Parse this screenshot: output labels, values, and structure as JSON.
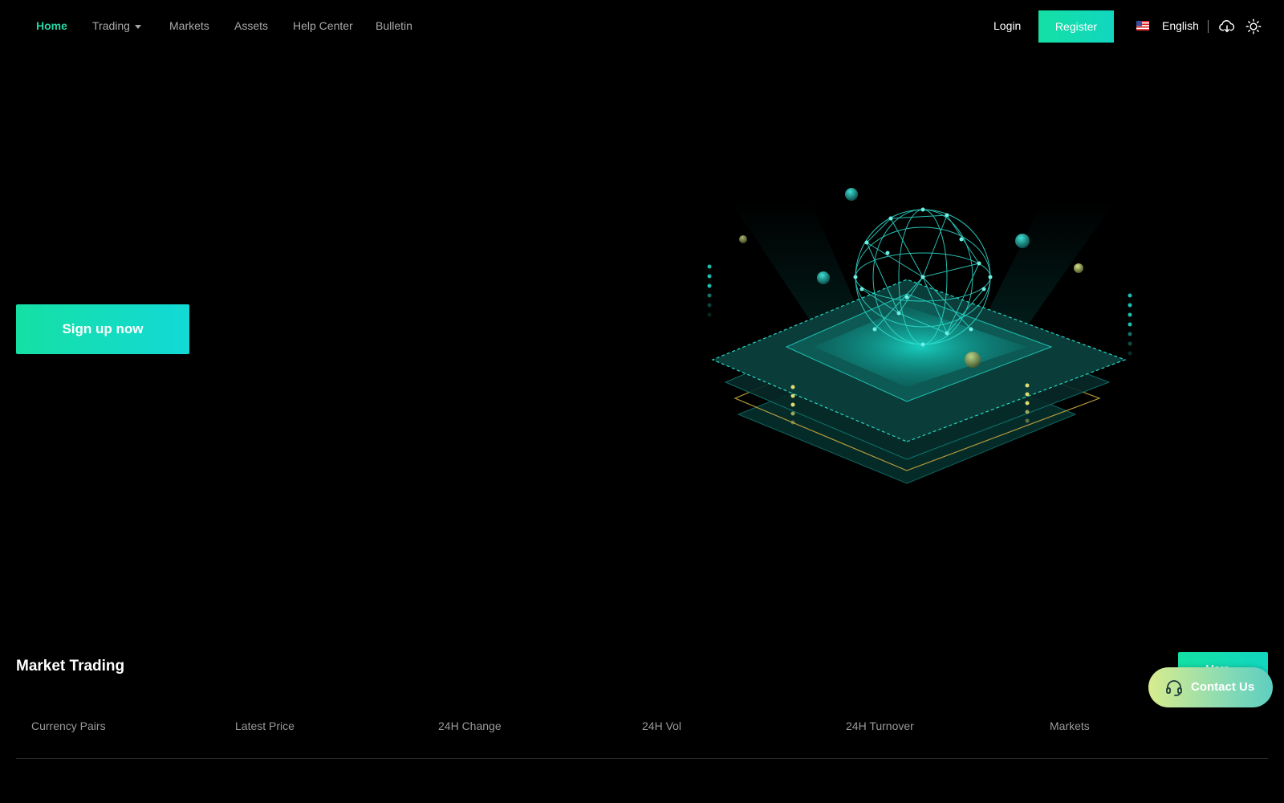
{
  "nav": {
    "links": [
      {
        "label": "Home",
        "active": true
      },
      {
        "label": "Trading",
        "dropdown": true
      },
      {
        "label": "Markets"
      },
      {
        "label": "Assets"
      },
      {
        "label": "Help Center"
      },
      {
        "label": "Bulletin"
      }
    ],
    "login": "Login",
    "register": "Register",
    "language": "English",
    "flag_icon": "us-flag-icon",
    "download_icon": "cloud-download-icon",
    "theme_icon": "sun-icon"
  },
  "hero": {
    "signup": "Sign up now",
    "illustration": "network-globe-illustration"
  },
  "market": {
    "title": "Market Trading",
    "more": "More",
    "columns": [
      "Currency Pairs",
      "Latest Price",
      "24H Change",
      "24H Vol",
      "24H Turnover",
      "Markets"
    ]
  },
  "contact": {
    "label": "Contact Us",
    "icon": "headset-icon"
  },
  "colors": {
    "accent": "#14e0a4",
    "accent_secondary": "#12d6c0",
    "background": "#000000",
    "muted_text": "#a8a8a8"
  }
}
